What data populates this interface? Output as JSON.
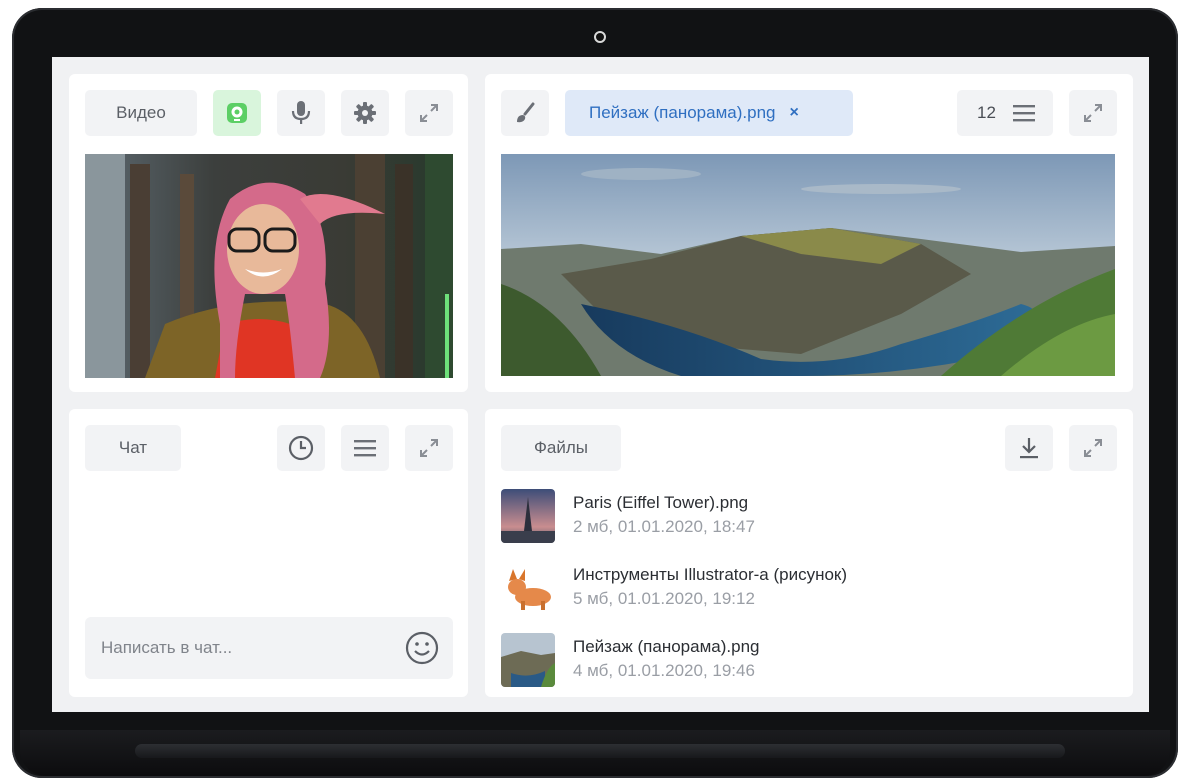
{
  "video_panel": {
    "tab_label": "Видео",
    "icons": [
      "webcam-icon",
      "microphone-icon",
      "gear-icon",
      "expand-icon"
    ],
    "webcam_active_color": "#5ccf65"
  },
  "viewer_panel": {
    "tool_icon": "brush-icon",
    "open_file_label": "Пейзаж (панорама).png",
    "close_label": "×",
    "count": "12",
    "accent": "#2f6fc1"
  },
  "chat_panel": {
    "tab_label": "Чат",
    "input_placeholder": "Написать в чат..."
  },
  "files_panel": {
    "tab_label": "Файлы",
    "items": [
      {
        "name": "Paris (Eiffel Tower).png",
        "meta": "2 мб, 01.01.2020, 18:47"
      },
      {
        "name": "Инструменты Illustrator-a (рисунок)",
        "meta": "5 мб, 01.01.2020, 19:12"
      },
      {
        "name": "Пейзаж (панорама).png",
        "meta": "4 мб, 01.01.2020, 19:46"
      }
    ]
  }
}
